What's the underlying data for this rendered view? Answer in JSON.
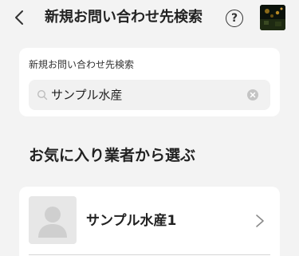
{
  "header": {
    "title": "新規お問い合わせ先検索",
    "help_glyph": "?",
    "back_icon": "chevron-left-icon",
    "help_icon": "question-circle-icon"
  },
  "search": {
    "label": "新規お問い合わせ先検索",
    "value": "サンプル水産",
    "icon": "search-icon",
    "clear_icon": "clear-circle-icon"
  },
  "favorites": {
    "title": "お気に入り業者から選ぶ",
    "items": [
      {
        "name": "サンプル水産1"
      }
    ]
  },
  "colors": {
    "background": "#f3f3f3",
    "card": "#ffffff",
    "input_background": "#f1f1f1",
    "text": "#222222",
    "placeholder_icon": "#bdbdbd"
  }
}
